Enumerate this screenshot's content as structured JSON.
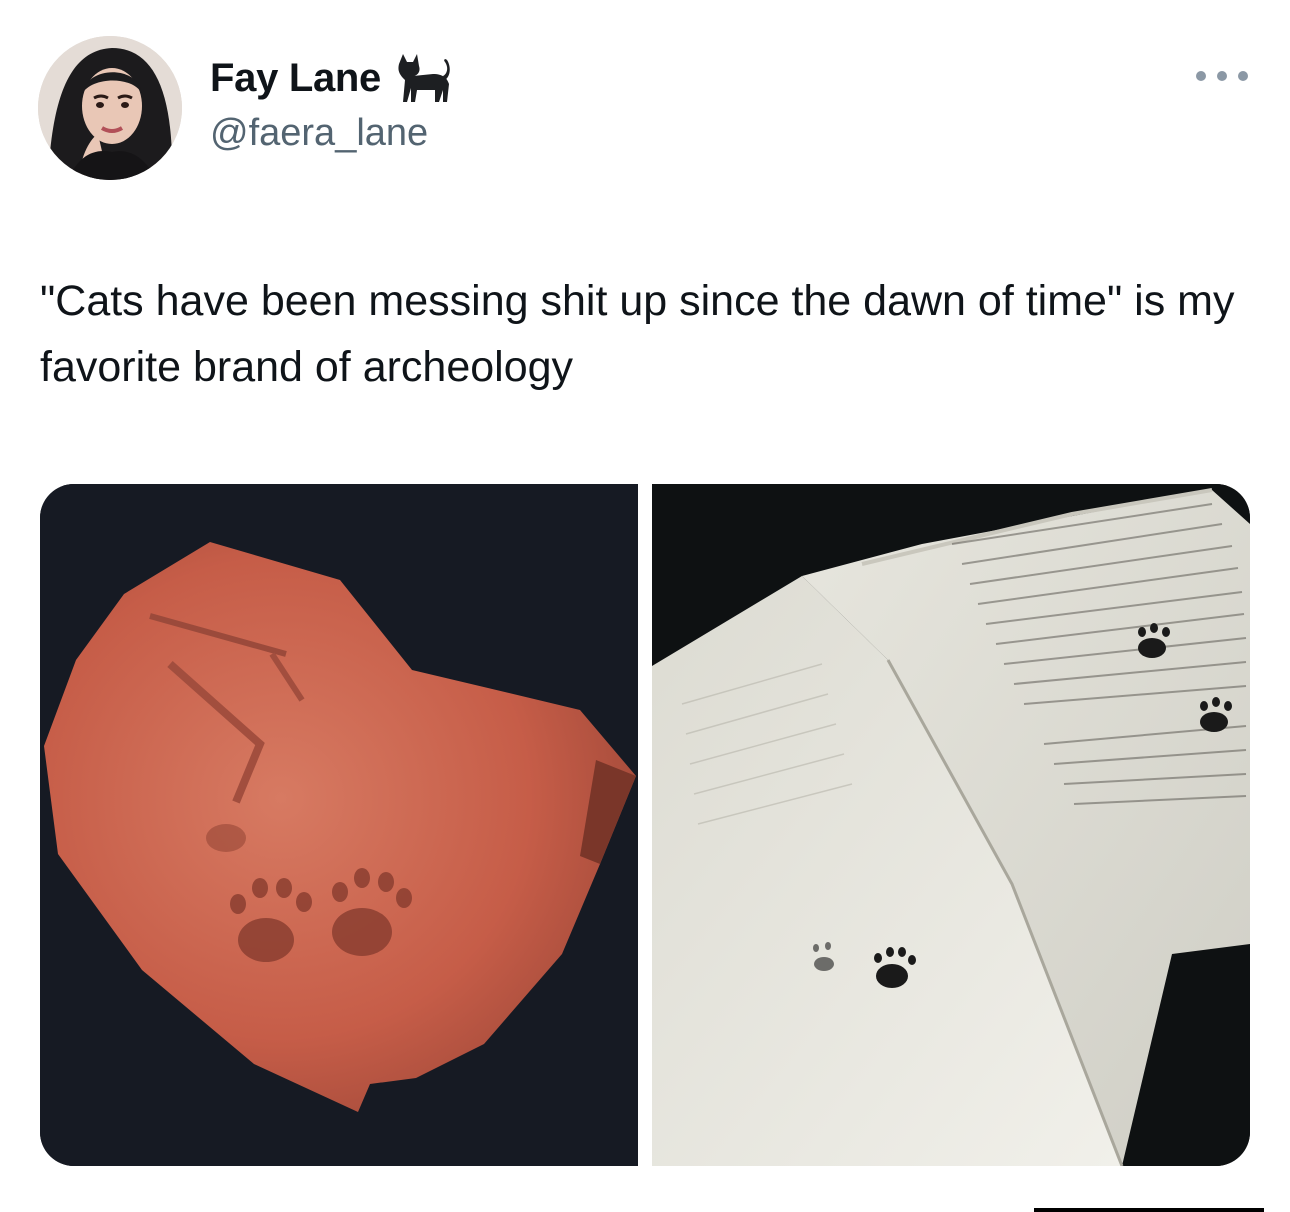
{
  "author": {
    "display_name": "Fay Lane",
    "handle": "@faera_lane",
    "avatar_icon": "avatar",
    "badge_icon": "cat-icon"
  },
  "tweet": {
    "text": "\"Cats have been messing shit up since the dawn of time\" is my favorite brand of archeology"
  },
  "menu": {
    "icon": "more-options-icon"
  },
  "media": {
    "count": 2,
    "images": [
      {
        "icon": "brick-with-paw-prints-photo"
      },
      {
        "icon": "manuscript-with-paw-prints-photo"
      }
    ]
  },
  "colors": {
    "text": "#0f1419",
    "secondary": "#536471",
    "brick": "#c8644e",
    "parchment": "#ecece4"
  }
}
